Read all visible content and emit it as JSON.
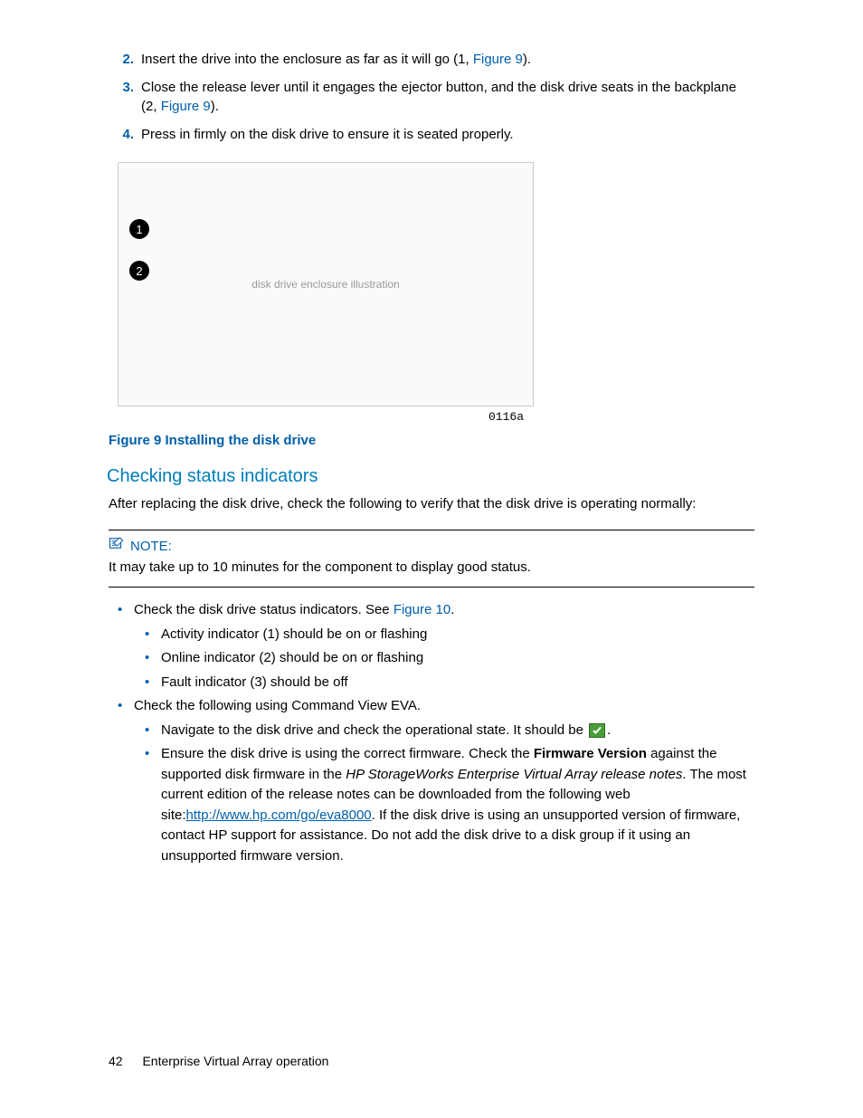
{
  "steps": {
    "s2": {
      "num": "2.",
      "text_a": "Insert the drive into the enclosure as far as it will go (1, ",
      "link": "Figure 9",
      "text_b": ")."
    },
    "s3": {
      "num": "3.",
      "text_a": "Close the release lever until it engages the ejector button, and the disk drive seats in the backplane (2, ",
      "link": "Figure 9",
      "text_b": ")."
    },
    "s4": {
      "num": "4.",
      "text": "Press in firmly on the disk drive to ensure it is seated properly."
    }
  },
  "figure": {
    "callout1": "1",
    "callout2": "2",
    "code": "0116a",
    "caption": "Figure 9 Installing the disk drive"
  },
  "section": {
    "heading": "Checking status indicators",
    "intro": "After replacing the disk drive, check the following to verify that the disk drive is operating normally:"
  },
  "note": {
    "label": "NOTE:",
    "text": "It may take up to 10 minutes for the component to display good status."
  },
  "bullets": {
    "b1": {
      "text_a": "Check the disk drive status indicators. See ",
      "link": "Figure 10",
      "text_b": "."
    },
    "b1a": "Activity indicator (1) should be on or flashing",
    "b1b": "Online indicator (2) should be on or flashing",
    "b1c": "Fault indicator (3) should be off",
    "b2": "Check the following using Command View EVA.",
    "b2a": {
      "text_a": "Navigate to the disk drive and check the operational state. It should be ",
      "text_b": "."
    },
    "b2b": {
      "t1": "Ensure the disk drive is using the correct firmware. Check the ",
      "strong": "Firmware Version",
      "t2": " against the supported disk firmware in the ",
      "italic": "HP StorageWorks Enterprise Virtual Array release notes",
      "t3": ". The most current edition of the release notes can be downloaded from the following web site:",
      "url": "http://www.hp.com/go/eva8000",
      "t4": ". If the disk drive is using an unsupported version of firmware, contact HP support for assistance. Do not add the disk drive to a disk group if it using an unsupported firmware version."
    }
  },
  "footer": {
    "page": "42",
    "title": "Enterprise Virtual Array operation"
  }
}
